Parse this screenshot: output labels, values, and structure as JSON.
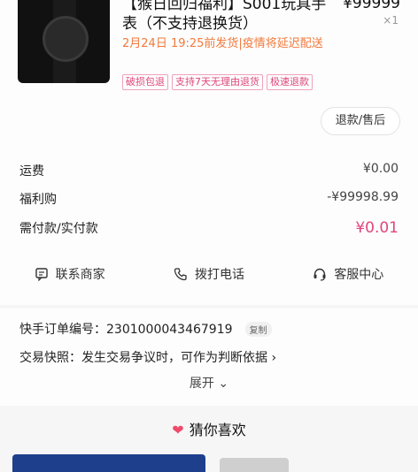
{
  "product": {
    "title": "【猴日回归福利】S001玩具手表（不支持退换货）",
    "price": "¥99999",
    "quantity": "×1",
    "notice": "2月24日 19:25前发货|疫情将延迟配送",
    "tags": [
      "破损包退",
      "支持7天无理由退货",
      "极速退款"
    ],
    "refund_label": "退款/售后"
  },
  "fees": {
    "shipping_label": "运费",
    "shipping_value": "¥0.00",
    "welfare_label": "福利购",
    "welfare_value": "-¥99998.99",
    "pay_label": "需付款/实付款",
    "pay_value": "¥0.01"
  },
  "actions": {
    "contact": "联系商家",
    "call": "拨打电话",
    "service": "客服中心"
  },
  "order": {
    "number_label": "快手订单编号：2301000043467919",
    "copy_label": "复制",
    "snapshot_label": "交易快照：发生交易争议时，可作为判断依据 ›",
    "expand_label": "展开 ⌄"
  },
  "recommend": {
    "title": "猜你喜欢"
  },
  "colors": {
    "accent": "#e0467c",
    "notice": "#f07a3c"
  }
}
